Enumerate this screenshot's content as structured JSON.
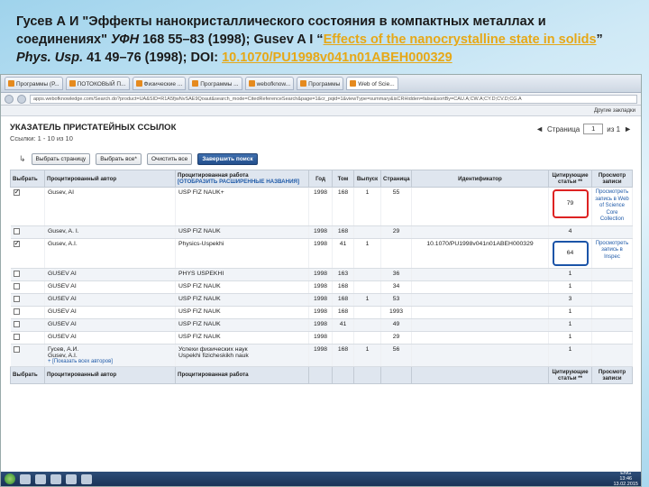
{
  "slide": {
    "title_part1": "Гусев А И \"Эффекты нанокристаллического состояния в компактных металлах и соединениях\" ",
    "title_journal": "УФН",
    "title_part2": " 168 55–83 (1998); Gusev A I “",
    "title_link": "Effects of the nanocrystalline state in solids",
    "title_part3": "” ",
    "title_journal2": "Phys. Usp.",
    "title_part4": " 41 49–76 (1998); DOI: ",
    "doi_link": "10.1070/PU1998v041n01ABEH000329"
  },
  "browser": {
    "tabs": [
      "Программы (Р...",
      "ПОТОКОВЫЙ П...",
      "Физические ...",
      "Программы ...",
      "webofknow...",
      "Программы",
      "Web of Scie..."
    ],
    "active_tab_index": 6,
    "url": "apps.webofknowledge.com/Search.do?product=UA&SID=R1A5fjwNvSAE9Qoaut&search_mode=CitedReferenceSearch&page=1&cr_pqid=1&viewType=summary&isCRHidden=false&sortBy=CAU.A;CW.A;CY.D;CV.D;CG.A",
    "bookmarks_label": "Другие закладки"
  },
  "page": {
    "title": "УКАЗАТЕЛЬ ПРИСТАТЕЙНЫХ ССЫЛОК",
    "links_line": "Ссылки:  1 - 10 из 10",
    "pager_label": "Страница",
    "pager_value": "1",
    "pager_of": "из 1"
  },
  "toolbar": {
    "select_page": "Выбрать страницу",
    "select_all": "Выбрать все*",
    "clear_all": "Очистить все",
    "finish": "Завершить поиск"
  },
  "table": {
    "headers": {
      "select": "Выбрать",
      "author": "Процитированный автор",
      "work": "Процитированная работа",
      "work_expand": "[ОТОБРАЗИТЬ РАСШИРЕННЫЕ НАЗВАНИЯ]",
      "year": "Год",
      "volume": "Том",
      "issue": "Выпуск",
      "page": "Страница",
      "identifier": "Идентификатор",
      "citing": "Цитирующие статьи **",
      "view": "Просмотр записи"
    },
    "rows": [
      {
        "checked": true,
        "author": "Gusev, AI",
        "work": "USP FIZ NAUK+",
        "year": "1998",
        "volume": "168",
        "issue": "1",
        "page": "55",
        "identifier": "",
        "citing": "79",
        "view": "Просмотреть запись в Web of Science Core Collection",
        "highlight": "red"
      },
      {
        "checked": false,
        "author": "Gusev, A. I.",
        "work": "USP FIZ NAUK",
        "year": "1998",
        "volume": "168",
        "issue": "",
        "page": "29",
        "identifier": "",
        "citing": "4",
        "view": "",
        "highlight": ""
      },
      {
        "checked": true,
        "author": "Gusev, A.I.",
        "work": "Physics-Uspekhi",
        "year": "1998",
        "volume": "41",
        "issue": "1",
        "page": "",
        "identifier": "10.1070/PU1998v041n01ABEH000329",
        "citing": "64",
        "view": "Просмотреть запись в Inspec",
        "highlight": "blue"
      },
      {
        "checked": false,
        "author": "GUSEV AI",
        "work": "PHYS USPEKHI",
        "year": "1998",
        "volume": "163",
        "issue": "",
        "page": "36",
        "identifier": "",
        "citing": "1",
        "view": "",
        "highlight": ""
      },
      {
        "checked": false,
        "author": "GUSEV AI",
        "work": "USP FIZ NAUK",
        "year": "1998",
        "volume": "168",
        "issue": "",
        "page": "34",
        "identifier": "",
        "citing": "1",
        "view": "",
        "highlight": ""
      },
      {
        "checked": false,
        "author": "GUSEV AI",
        "work": "USP FIZ NAUK",
        "year": "1998",
        "volume": "168",
        "issue": "1",
        "page": "53",
        "identifier": "",
        "citing": "3",
        "view": "",
        "highlight": ""
      },
      {
        "checked": false,
        "author": "GUSEV AI",
        "work": "USP FIZ NAUK",
        "year": "1998",
        "volume": "168",
        "issue": "",
        "page": "1993",
        "identifier": "",
        "citing": "1",
        "view": "",
        "highlight": ""
      },
      {
        "checked": false,
        "author": "GUSEV AI",
        "work": "USP FIZ NAUK",
        "year": "1998",
        "volume": "41",
        "issue": "",
        "page": "49",
        "identifier": "",
        "citing": "1",
        "view": "",
        "highlight": ""
      },
      {
        "checked": false,
        "author": "GUSEV AI",
        "work": "USP FIZ NAUK",
        "year": "1998",
        "volume": "",
        "issue": "",
        "page": "29",
        "identifier": "",
        "citing": "1",
        "view": "",
        "highlight": ""
      },
      {
        "checked": false,
        "author": "Гусев, А.И.",
        "author2": "Gusev, A.I.",
        "show_all": "+ [Показать всех авторов]",
        "work": "Успехи физических наук",
        "work2": "Uspekhi fizicheskikh nauk",
        "year": "1998",
        "volume": "168",
        "issue": "1",
        "page": "56",
        "identifier": "",
        "citing": "1",
        "view": "",
        "highlight": ""
      }
    ],
    "footer": {
      "select": "Выбрать",
      "author": "Процитированный автор",
      "work": "Процитированная работа",
      "citing": "Цитирующие статьи **",
      "view": "Просмотр записи"
    }
  },
  "taskbar": {
    "lang": "ENG",
    "time": "13:46",
    "date": "13.02.2015"
  }
}
